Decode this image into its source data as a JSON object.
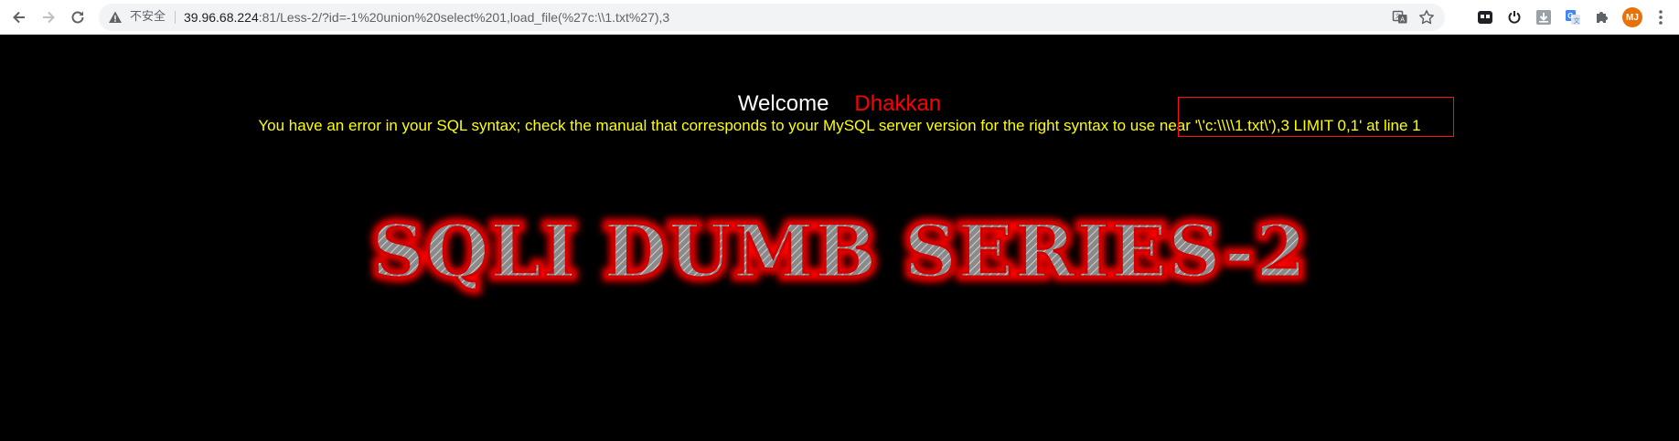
{
  "browser": {
    "security_label": "不安全",
    "url_host": "39.96.68.224",
    "url_path": ":81/Less-2/?id=-1%20union%20select%201,load_file(%27c:\\\\1.txt%27),3",
    "avatar_initials": "MJ"
  },
  "page": {
    "welcome_label": "Welcome",
    "username": "Dhakkan",
    "error_message": "You have an error in your SQL syntax; check the manual that corresponds to your MySQL server version for the right syntax to use near '\\'c:\\\\\\\\1.txt\\'),3 LIMIT 0,1' at line 1",
    "banner_text": "SQLI DUMB SERIES-2"
  },
  "colors": {
    "background": "#000000",
    "welcome": "#ffffff",
    "username": "#ff0000",
    "error": "#ffff00",
    "annotation_box": "#ff1010",
    "banner_glow": "#ff0000"
  },
  "icons": {
    "back": "back-arrow-icon",
    "forward": "forward-arrow-icon",
    "reload": "reload-icon",
    "warning": "warning-icon",
    "translate": "translate-icon",
    "bookmark": "star-icon",
    "extensions": [
      "media-extension-icon",
      "power-extension-icon",
      "download-extension-icon",
      "google-translate-icon",
      "puzzle-icon"
    ],
    "menu": "kebab-menu-icon"
  }
}
